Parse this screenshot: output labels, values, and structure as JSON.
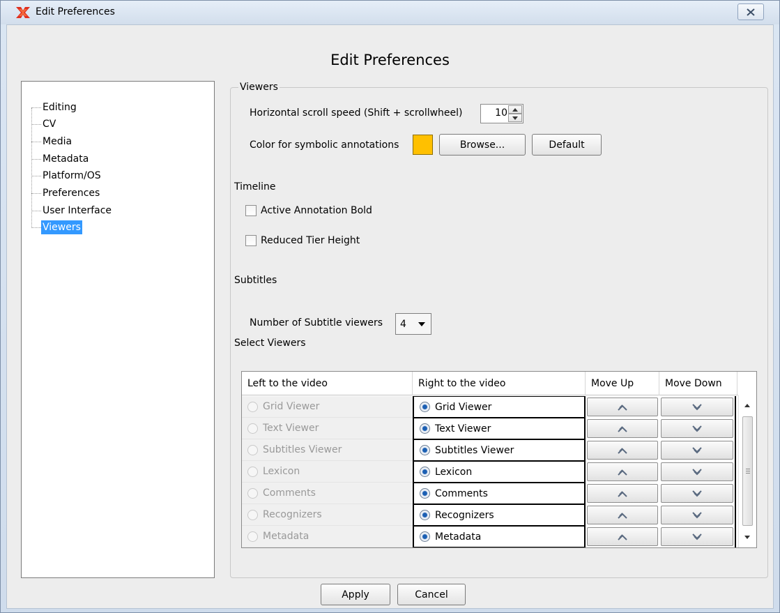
{
  "window": {
    "title": "Edit Preferences",
    "close_label": "✕"
  },
  "heading": "Edit Preferences",
  "tree": {
    "items": [
      {
        "label": "Editing"
      },
      {
        "label": "CV"
      },
      {
        "label": "Media"
      },
      {
        "label": "Metadata"
      },
      {
        "label": "Platform/OS"
      },
      {
        "label": "Preferences"
      },
      {
        "label": "User Interface"
      },
      {
        "label": "Viewers",
        "selected": true
      }
    ]
  },
  "viewers": {
    "legend": "Viewers",
    "scroll_label": "Horizontal scroll speed (Shift + scrollwheel)",
    "scroll_value": "10",
    "color_label": "Color for symbolic annotations",
    "color_value": "#ffc000",
    "browse_label": "Browse...",
    "default_label": "Default"
  },
  "timeline": {
    "title": "Timeline",
    "bold_label": "Active Annotation Bold",
    "bold_checked": false,
    "reduced_label": "Reduced Tier Height",
    "reduced_checked": false
  },
  "subtitles": {
    "title": "Subtitles",
    "count_label": "Number of Subtitle viewers",
    "count_value": "4"
  },
  "select_viewers": {
    "title": "Select Viewers",
    "columns": [
      "Left to the  video",
      "Right to the video",
      "Move Up",
      "Move Down"
    ],
    "rows": [
      {
        "left": "Grid Viewer",
        "right": "Grid Viewer"
      },
      {
        "left": "Text Viewer",
        "right": "Text Viewer"
      },
      {
        "left": "Subtitles Viewer",
        "right": "Subtitles Viewer"
      },
      {
        "left": "Lexicon",
        "right": "Lexicon"
      },
      {
        "left": "Comments",
        "right": "Comments"
      },
      {
        "left": "Recognizers",
        "right": "Recognizers"
      },
      {
        "left": "Metadata",
        "right": "Metadata"
      }
    ]
  },
  "footer": {
    "apply_label": "Apply",
    "cancel_label": "Cancel"
  }
}
